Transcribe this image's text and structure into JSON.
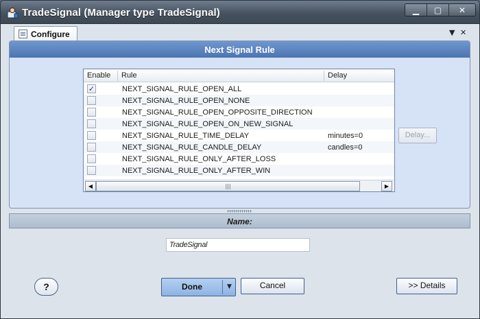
{
  "window": {
    "title": "TradeSignal (Manager type TradeSignal)",
    "controls": {
      "minimize": "▁",
      "maximize": "▢",
      "close": "✕"
    }
  },
  "tabs": {
    "active_label": "Configure",
    "menu_glyph": "▼",
    "close_glyph": "✕"
  },
  "panel": {
    "title": "Next Signal Rule"
  },
  "grid": {
    "columns": {
      "enable": "Enable",
      "rule": "Rule",
      "delay": "Delay"
    },
    "rows": [
      {
        "enabled": true,
        "check": "✓",
        "rule": "NEXT_SIGNAL_RULE_OPEN_ALL",
        "delay": ""
      },
      {
        "enabled": false,
        "check": "",
        "rule": "NEXT_SIGNAL_RULE_OPEN_NONE",
        "delay": ""
      },
      {
        "enabled": false,
        "check": "",
        "rule": "NEXT_SIGNAL_RULE_OPEN_OPPOSITE_DIRECTION",
        "delay": ""
      },
      {
        "enabled": false,
        "check": "",
        "rule": "NEXT_SIGNAL_RULE_OPEN_ON_NEW_SIGNAL",
        "delay": ""
      },
      {
        "enabled": false,
        "check": "",
        "rule": "NEXT_SIGNAL_RULE_TIME_DELAY",
        "delay": "minutes=0"
      },
      {
        "enabled": false,
        "check": "",
        "rule": "NEXT_SIGNAL_RULE_CANDLE_DELAY",
        "delay": "candles=0"
      },
      {
        "enabled": false,
        "check": "",
        "rule": "NEXT_SIGNAL_RULE_ONLY_AFTER_LOSS",
        "delay": ""
      },
      {
        "enabled": false,
        "check": "",
        "rule": "NEXT_SIGNAL_RULE_ONLY_AFTER_WIN",
        "delay": ""
      }
    ],
    "scroll": {
      "left": "◀",
      "thumb": "|||",
      "right": "▶"
    }
  },
  "delay_button": {
    "label": "Delay..."
  },
  "name_section": {
    "label": "Name:",
    "value": "TradeSignal"
  },
  "footer": {
    "help": "?",
    "done": "Done",
    "done_arrow": "▼",
    "cancel": "Cancel",
    "details": ">> Details"
  }
}
